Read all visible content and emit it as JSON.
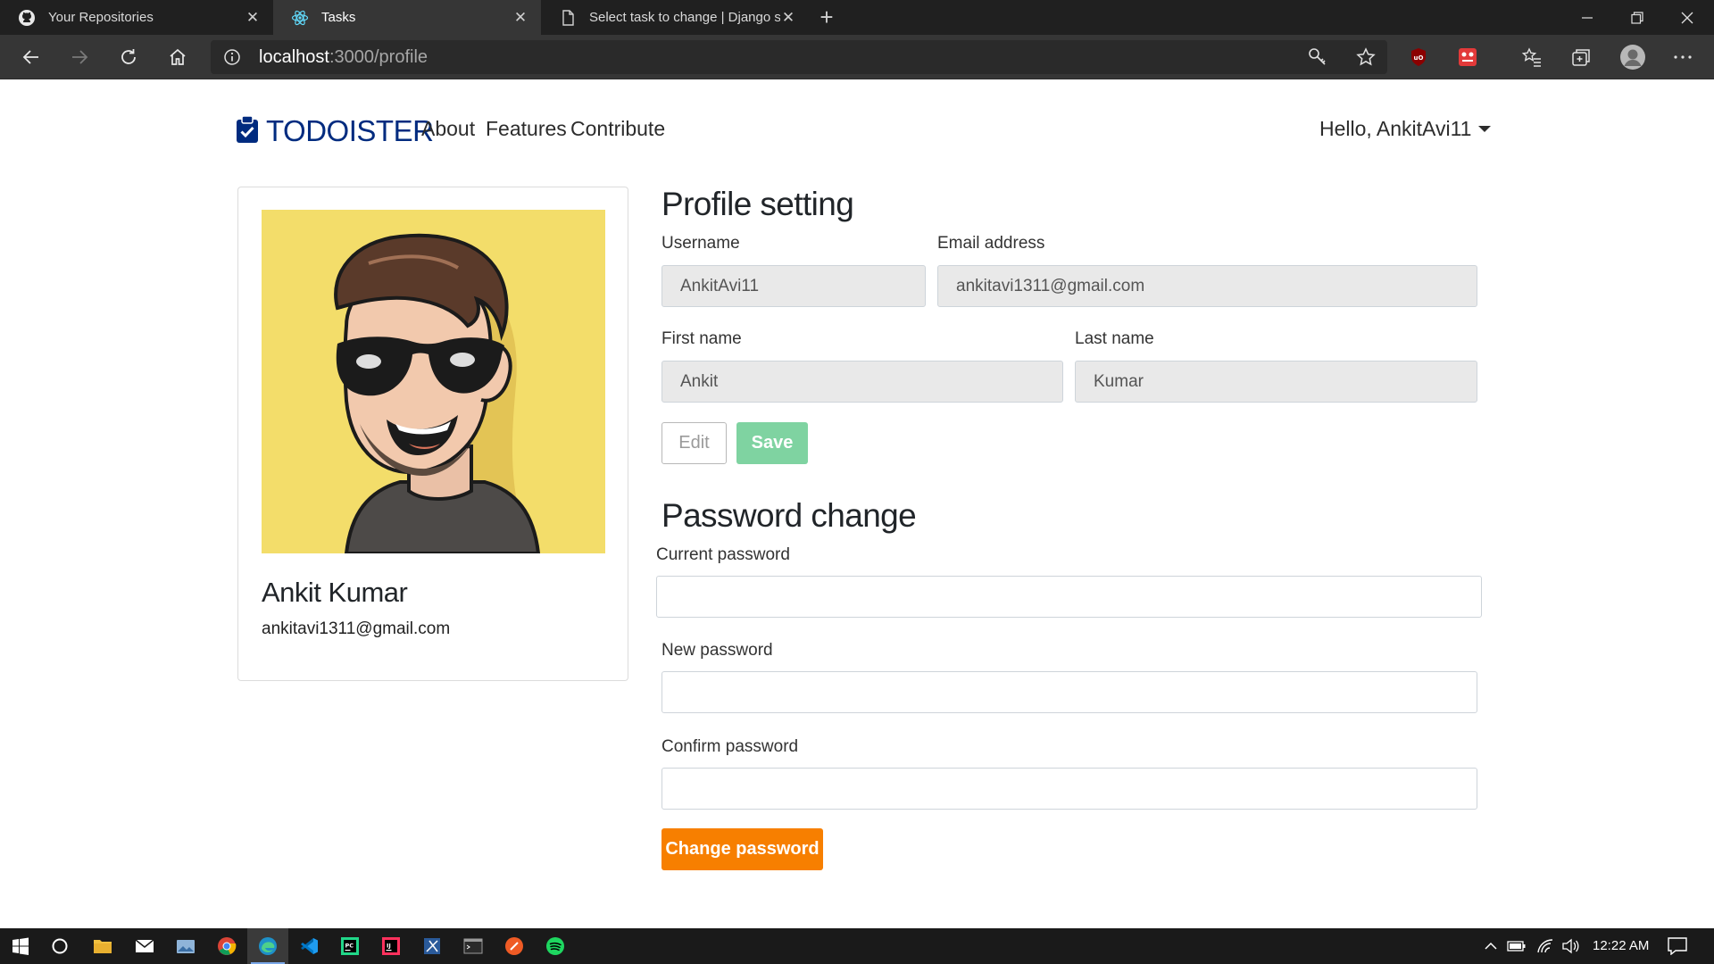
{
  "browser": {
    "tabs": [
      {
        "title": "Your Repositories",
        "icon": "github-icon"
      },
      {
        "title": "Tasks",
        "icon": "react-icon"
      },
      {
        "title": "Select task to change | Django si",
        "icon": "page-icon"
      }
    ],
    "address": {
      "host": "localhost",
      "path": ":3000/profile"
    }
  },
  "navbar": {
    "brand": "TODOISTER",
    "links": [
      "About",
      "Features",
      "Contribute"
    ],
    "user_menu": "Hello, AnkitAvi11"
  },
  "profile_card": {
    "name": "Ankit Kumar",
    "email": "ankitavi1311@gmail.com"
  },
  "profile_setting": {
    "heading": "Profile setting",
    "username_label": "Username",
    "username_value": "AnkitAvi11",
    "email_label": "Email address",
    "email_value": "ankitavi1311@gmail.com",
    "first_name_label": "First name",
    "first_name_value": "Ankit",
    "last_name_label": "Last name",
    "last_name_value": "Kumar",
    "edit_label": "Edit",
    "save_label": "Save"
  },
  "password_change": {
    "heading": "Password change",
    "current_label": "Current password",
    "new_label": "New password",
    "confirm_label": "Confirm password",
    "button_label": "Change password"
  },
  "taskbar": {
    "clock": "12:22 AM"
  },
  "colors": {
    "brand": "#002b7f",
    "save": "#7fd3a1",
    "change_password": "#f77f00",
    "avatar_bg": "#f3dd6a"
  }
}
